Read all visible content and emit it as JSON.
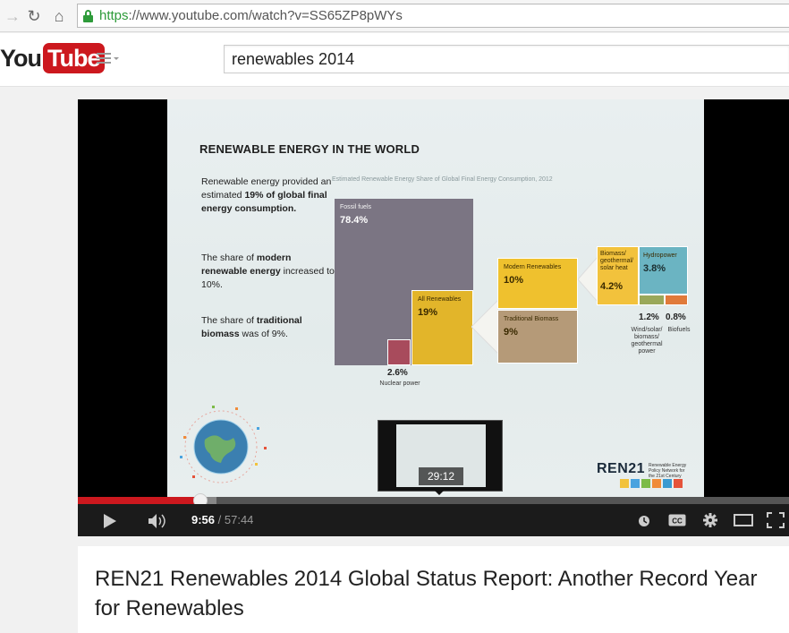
{
  "browser": {
    "url_https": "https",
    "url_rest": "://www.youtube.com/watch?v=SS65ZP8pWYs"
  },
  "header": {
    "logo_you": "You",
    "logo_tube": "Tube",
    "search_value": "renewables 2014"
  },
  "slide": {
    "title": "RENEWABLE ENERGY IN THE WORLD",
    "caption": "Estimated Renewable Energy Share of Global Final Energy Consumption, 2012",
    "text1_a": "Renewable energy provided an estimated ",
    "text1_b": "19% of global final energy consumption.",
    "text2_a": "The share of ",
    "text2_b": "modern renewable energy",
    "text2_c": " increased to 10%.",
    "text3_a": "The share of ",
    "text3_b": "traditional biomass",
    "text3_c": " was of 9%.",
    "fossil_label": "Fossil fuels",
    "fossil_pct": "78.4%",
    "allren_label": "All Renewables",
    "allren_pct": "19%",
    "nuclear_pct": "2.6%",
    "nuclear_label": "Nuclear power",
    "modern_label": "Modern Renewables",
    "modern_pct": "10%",
    "trad_label": "Traditional Biomass",
    "trad_pct": "9%",
    "biomass_label": "Biomass/ geothermal/ solar heat",
    "biomass_pct": "4.2%",
    "hydro_label": "Hydropower",
    "hydro_pct": "3.8%",
    "wind_pct": "1.2%",
    "biofuels_pct": "0.8%",
    "wind_label": "Wind/solar/ biomass/ geothermal power",
    "biofuels_label": "Biofuels",
    "ren21_name": "REN21",
    "ren21_sub": "Renewable Energy Policy Network for the 21st Century"
  },
  "player": {
    "preview_time": "29:12",
    "current_time": "9:56",
    "separator": " / ",
    "duration": "57:44",
    "played_fraction": 0.172,
    "loaded_fraction": 0.195
  },
  "video": {
    "title": "REN21 Renewables 2014 Global Status Report: Another Record Year for Renewables"
  },
  "colors": {
    "yt_red": "#cc181e",
    "fossil": "#7b7583",
    "renewables": "#e2b52a",
    "nuclear": "#a84b5c",
    "modern": "#efc12e",
    "traditional": "#b59a78",
    "hydro": "#6bb4c2",
    "biomass": "#f2c23c"
  }
}
